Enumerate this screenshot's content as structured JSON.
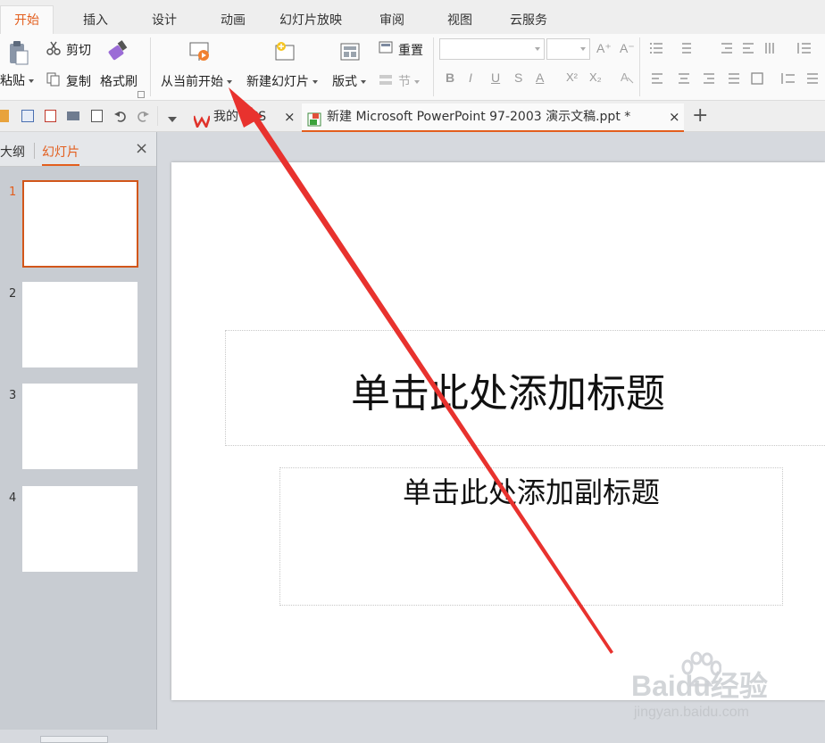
{
  "menu": {
    "tabs": [
      "开始",
      "插入",
      "设计",
      "动画",
      "幻灯片放映",
      "审阅",
      "视图",
      "云服务"
    ]
  },
  "ribbon": {
    "paste": "粘贴",
    "cut": "剪切",
    "copy": "复制",
    "format_painter": "格式刷",
    "from_current": "从当前开始",
    "new_slide": "新建幻灯片",
    "layout": "版式",
    "reset": "重置",
    "section": "节",
    "bold": "B",
    "italic": "I",
    "underline": "U",
    "strike": "S",
    "font_color": "A",
    "superscript": "X²",
    "subscript": "X₂",
    "grow_font": "A⁺",
    "shrink_font": "A⁻"
  },
  "tabbar": {
    "my_wps": "我的WPS",
    "document": "新建 Microsoft PowerPoint 97-2003 演示文稿.ppt *",
    "close_glyph": "×",
    "new_tab_glyph": "+"
  },
  "panel": {
    "outline_tab": "大纲",
    "slides_tab": "幻灯片",
    "close_glyph": "×",
    "thumbnails": [
      "1",
      "2",
      "3",
      "4"
    ]
  },
  "slide": {
    "title_placeholder": "单击此处添加标题",
    "subtitle_placeholder": "单击此处添加副标题"
  },
  "watermark": {
    "brand": "Baidu经验",
    "url": "jingyan.baidu.com"
  },
  "colors": {
    "accent": "#e35e1d",
    "arrow": "#e8322e"
  }
}
